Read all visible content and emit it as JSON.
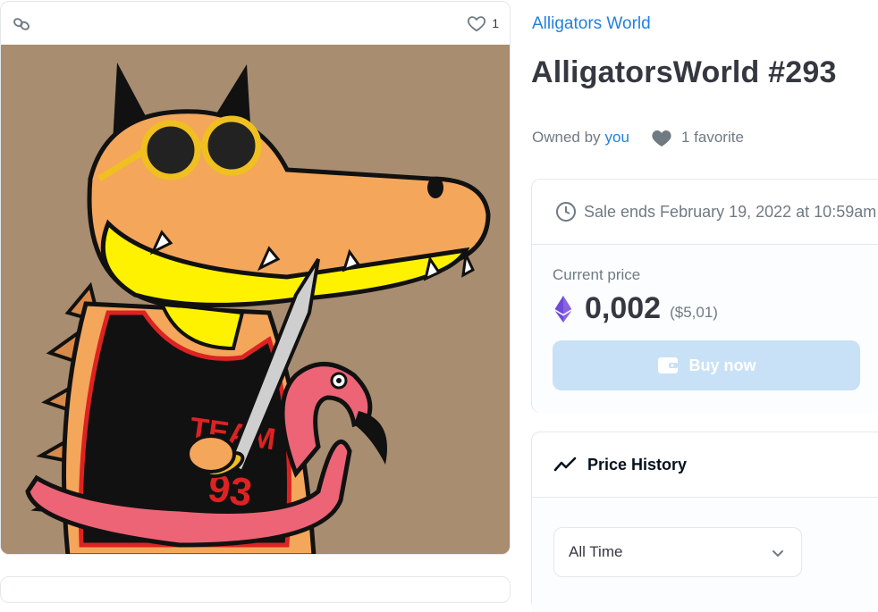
{
  "asset": {
    "favorites_count": "1",
    "chain_icon": "chain-link-icon",
    "image_description_icon": "nft-artwork"
  },
  "collection": {
    "name": "Alligators World"
  },
  "item": {
    "title": "AlligatorsWorld #293",
    "owned_by_label": "Owned by",
    "owner": "you",
    "favorites_text": "1 favorite"
  },
  "sale": {
    "ends_text": "Sale ends February 19, 2022 at 10:59am",
    "current_price_label": "Current price",
    "price": "0,002",
    "price_usd": "($5,01)",
    "buy_label": "Buy now"
  },
  "price_history": {
    "title": "Price History",
    "range_selected": "All Time"
  },
  "colors": {
    "accent": "#2081e2",
    "buy_disabled": "#c9e1f6",
    "art_bg": "#a88d70",
    "eth": "#6f4bd8"
  }
}
